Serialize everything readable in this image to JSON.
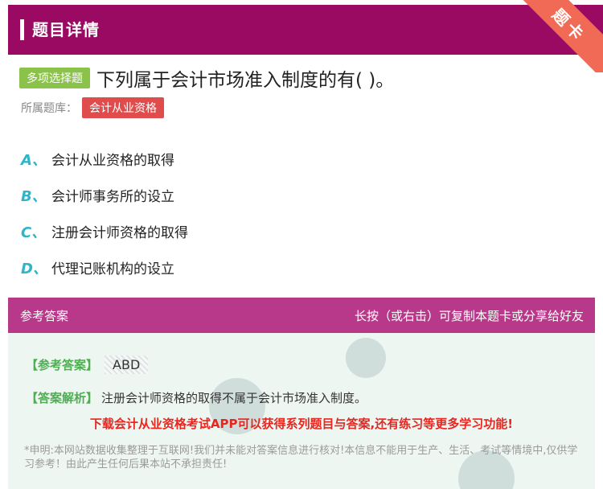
{
  "header": {
    "title": "题目详情",
    "ribbon": "题卡"
  },
  "question": {
    "type_badge": "多项选择题",
    "text": "下列属于会计市场准入制度的有( )。",
    "bank_label": "所属题库：",
    "bank_name": "会计从业资格"
  },
  "options": [
    {
      "letter": "A、",
      "text": "会计从业资格的取得"
    },
    {
      "letter": "B、",
      "text": "会计师事务所的设立"
    },
    {
      "letter": "C、",
      "text": "注册会计师资格的取得"
    },
    {
      "letter": "D、",
      "text": "代理记账机构的设立"
    }
  ],
  "answer": {
    "head_left": "参考答案",
    "head_right": "长按（或右击）可复制本题卡或分享给好友",
    "ref_label": "【参考答案】",
    "ref_value": "ABD",
    "analysis_label": "【答案解析】",
    "analysis_text": "注册会计师资格的取得不属于会计市场准入制度。",
    "promo": "下载会计从业资格考试APP可以获得系列题目与答案,还有练习等更多学习功能!",
    "disclaimer": "*申明:本网站数据收集整理于互联网!我们并未能对答案信息进行核对!本信息不能用于生产、生活、考试等情境中,仅供学习参考！由此产生任何后果本站不承担责任!"
  },
  "colors": {
    "header_bg": "#9a0a63",
    "answer_head_bg": "#b8398a",
    "option_letter": "#2fb5c6",
    "type_badge": "#8bc34a",
    "bank_badge": "#e04b4b",
    "promo": "#e8261f",
    "label_green": "#4caf50"
  }
}
